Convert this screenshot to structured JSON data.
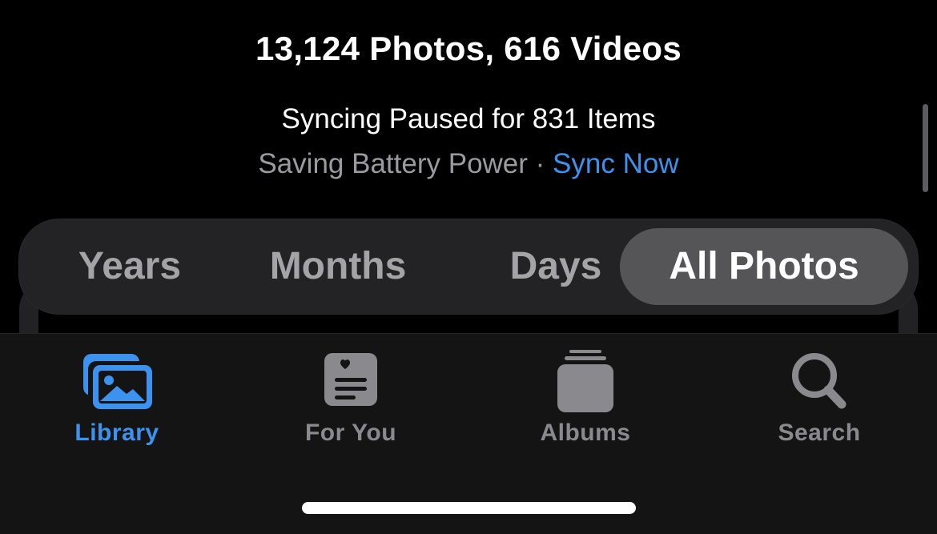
{
  "library_summary": {
    "counts": "13,124 Photos, 616 Videos",
    "sync_status": "Syncing Paused for 831 Items",
    "sync_reason": "Saving Battery Power",
    "separator": " · ",
    "sync_now_label": "Sync Now"
  },
  "view_picker": {
    "segments": [
      {
        "label": "Years",
        "selected": false
      },
      {
        "label": "Months",
        "selected": false
      },
      {
        "label": "Days",
        "selected": false
      },
      {
        "label": "All Photos",
        "selected": true
      }
    ]
  },
  "tab_bar": {
    "tabs": [
      {
        "label": "Library",
        "icon": "photo-stack-icon",
        "active": true
      },
      {
        "label": "For You",
        "icon": "for-you-icon",
        "active": false
      },
      {
        "label": "Albums",
        "icon": "albums-stack-icon",
        "active": false
      },
      {
        "label": "Search",
        "icon": "search-icon",
        "active": false
      }
    ]
  },
  "colors": {
    "accent": "#3b93ef",
    "background": "#000000",
    "tab_bar_bg": "#141414",
    "inactive": "#8a8a8e"
  }
}
